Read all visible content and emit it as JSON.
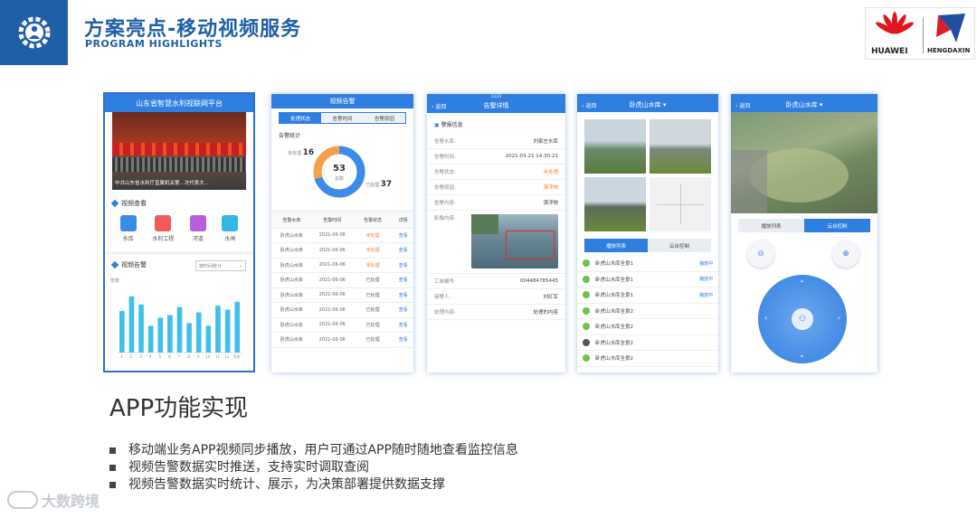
{
  "header": {
    "title": "方案亮点-移动视频服务",
    "subtitle": "PROGRAM HIGHLIGHTS",
    "badge_icon": "gear-worker-icon"
  },
  "logos": {
    "left_name": "HUAWEI",
    "right_name": "HENGDAXIN"
  },
  "phone1": {
    "title": "山东省智慧水利视联网平台",
    "banner_caption": "中共山东省水利厅直属机关第...次代表大...",
    "video_section": "视频查看",
    "icons": [
      "水库",
      "水利工程",
      "河道",
      "水闸"
    ],
    "alarm_section": "视频告警",
    "dropdown": "按时间统计",
    "y_label": "告数",
    "x_ticks": [
      "1",
      "2",
      "3",
      "4",
      "5",
      "6",
      "7",
      "8",
      "9",
      "10",
      "11",
      "12",
      "月份"
    ],
    "bars": [
      31,
      42,
      36,
      20,
      26,
      28,
      34,
      22,
      30,
      20,
      35,
      32,
      38
    ]
  },
  "phone2": {
    "title": "视频告警",
    "tabs": [
      "处理状态",
      "告警时间",
      "告警原因"
    ],
    "stats_label": "告警统计",
    "total": "53",
    "total_label": "总数",
    "unhandled": "16",
    "unhandled_label": "未处理",
    "handled": "37",
    "handled_label": "已处理",
    "headers": [
      "告警水库",
      "告警时间",
      "告警状态",
      "详情"
    ],
    "rows": [
      [
        "卧虎山水库",
        "2021-06-06",
        "未处理",
        "查看"
      ],
      [
        "卧虎山水库",
        "2021-06-06",
        "未处理",
        "查看"
      ],
      [
        "卧虎山水库",
        "2021-06-06",
        "未处理",
        "查看"
      ],
      [
        "卧虎山水库",
        "2021-06-06",
        "已处理",
        "查看"
      ],
      [
        "卧虎山水库",
        "2021-06-06",
        "已处理",
        "查看"
      ],
      [
        "卧虎山水库",
        "2021-06-06",
        "已处理",
        "查看"
      ],
      [
        "卧虎山水库",
        "2021-06-06",
        "已处理",
        "查看"
      ],
      [
        "卧虎山水库",
        "2021-06-06",
        "已处理",
        "查看"
      ]
    ]
  },
  "phone3": {
    "status_time": "13:22",
    "back": "返回",
    "title": "告警详情",
    "info_header": "警报信息",
    "fields": [
      {
        "k": "告警水库:",
        "v": "刘家庄水库",
        "warn": false
      },
      {
        "k": "告警时间:",
        "v": "2021-03-21 14:30:21",
        "warn": false
      },
      {
        "k": "告警状态:",
        "v": "未处理",
        "warn": true
      },
      {
        "k": "告警原因:",
        "v": "漂浮物",
        "warn": true
      },
      {
        "k": "告警内容:",
        "v": "漂浮物",
        "warn": false
      }
    ],
    "image_label": "影像内容:",
    "fields2": [
      {
        "k": "工单编号:",
        "v": "004484785445"
      },
      {
        "k": "接警人:",
        "v": "刘红军"
      },
      {
        "k": "处理内容:",
        "v": "处理的内容"
      }
    ]
  },
  "phone4": {
    "back": "返回",
    "title": "卧虎山水库 ▾",
    "tabs": [
      "播放列表",
      "云台控制"
    ],
    "items": [
      {
        "name": "卧虎山水库全景1",
        "status": "播放中"
      },
      {
        "name": "卧虎山水库全景1",
        "status": "播放中"
      },
      {
        "name": "卧虎山水库全景1",
        "status": "播放中"
      },
      {
        "name": "卧虎山水库全景2",
        "status": ""
      },
      {
        "name": "卧虎山水库全景2",
        "status": ""
      },
      {
        "name": "卧虎山水库全景2",
        "status": ""
      },
      {
        "name": "卧虎山水库全景2",
        "status": ""
      }
    ]
  },
  "phone5": {
    "back": "返回",
    "title": "卧虎山水库 ▾",
    "tabs": [
      "播放列表",
      "云台控制"
    ]
  },
  "section_title": "APP功能实现",
  "bullets": [
    "移动端业务APP视频同步播放，用户可通过APP随时随地查看监控信息",
    "视频告警数据实时推送，支持实时调取查阅",
    "视频告警数据实时统计、展示，为决策部署提供数据支撑"
  ],
  "watermark": "大数跨境"
}
